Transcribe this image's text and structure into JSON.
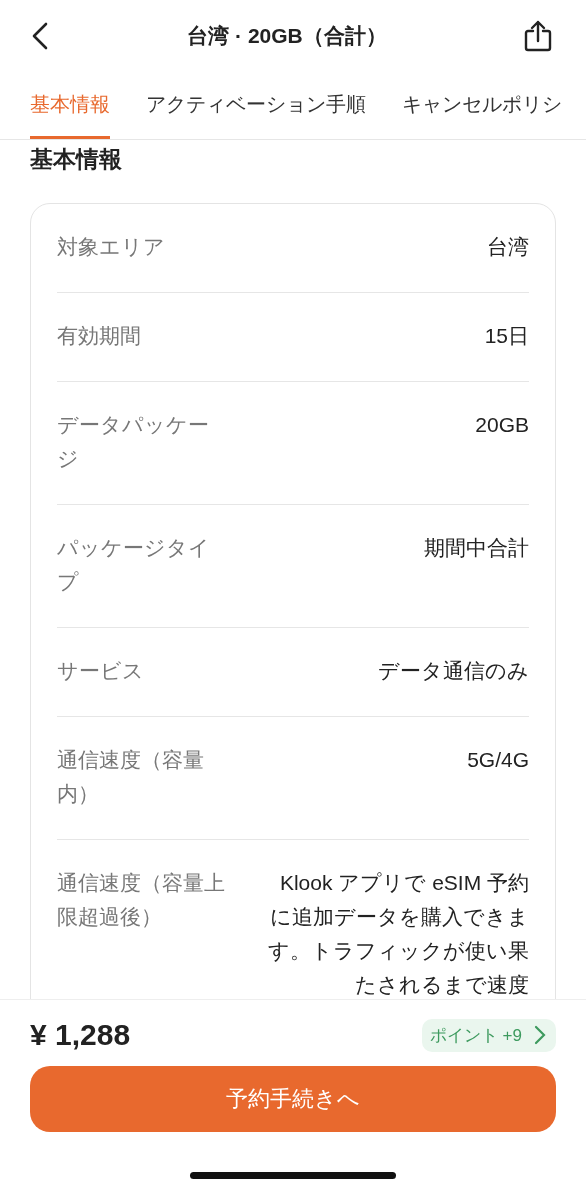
{
  "header": {
    "title": "台湾 · 20GB（合計）"
  },
  "tabs": [
    {
      "label": "基本情報",
      "selected": true
    },
    {
      "label": "アクティベーション手順",
      "selected": false
    },
    {
      "label": "キャンセルポリシ",
      "selected": false
    }
  ],
  "section": {
    "title": "基本情報"
  },
  "details": [
    {
      "label": "対象エリア",
      "value": "台湾"
    },
    {
      "label": "有効期間",
      "value": "15日"
    },
    {
      "label": "データパッケージ",
      "value": "20GB"
    },
    {
      "label": "パッケージタイプ",
      "value": "期間中合計"
    },
    {
      "label": "サービス",
      "value": "データ通信のみ"
    },
    {
      "label": "通信速度（容量内）",
      "value": "5G/4G"
    },
    {
      "label": "通信速度（容量上限超過後）",
      "value": "Klook アプリで eSIM 予約に追加データを購入できます。トラフィックが使い果たされるまで速度"
    }
  ],
  "footer": {
    "price": "¥ 1,288",
    "points": "ポイント +9",
    "button": "予約手続きへ"
  }
}
